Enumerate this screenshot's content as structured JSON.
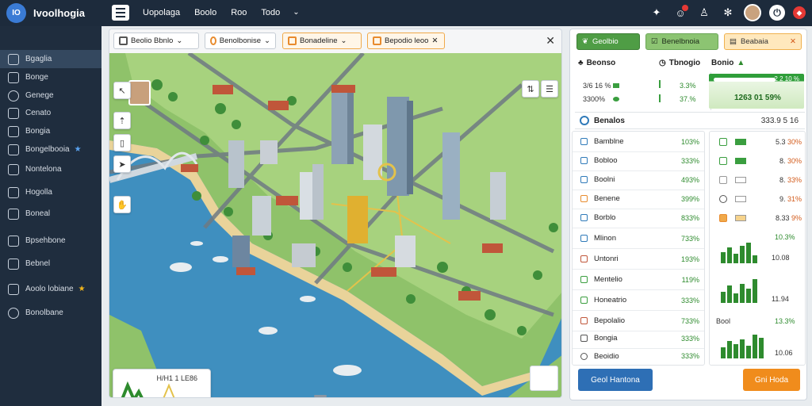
{
  "app": {
    "name": "Ivoolhogia",
    "logo_text": "IO"
  },
  "top_menu": {
    "items": [
      "Uopolaga",
      "Boolo",
      "Roo",
      "Todo"
    ]
  },
  "sidebar": {
    "items": [
      {
        "label": "Bgaglia",
        "active": true
      },
      {
        "label": "Bonge"
      },
      {
        "label": "Genege"
      },
      {
        "label": "Cenato"
      },
      {
        "label": "Bongia"
      },
      {
        "label": "Bongelbooia",
        "blue_star": true
      },
      {
        "label": "Nontelona"
      },
      {
        "label": "Hogolla"
      },
      {
        "label": "Boneal"
      },
      {
        "label": "Bpsehbone"
      },
      {
        "label": "Bebnel"
      },
      {
        "label": "Aoolo lobiane",
        "star": true
      },
      {
        "label": "Bonolbane"
      }
    ]
  },
  "map_tabs": {
    "tab1": "Beolio    Bbnlo",
    "tab2": "Benolbonise",
    "tab3": "Bonadeline",
    "tab4": "Bepodio  leoo"
  },
  "map_widget": {
    "text": "H/H1 1 LE86"
  },
  "right": {
    "tab1": "Geolbio",
    "tab2": "Benelbnoia",
    "tab3": "Beabaia",
    "summary_left_title": "Beonso",
    "summary_mid_title": "Tbnogio",
    "summary_right_title": "Bonio",
    "sum_rows": [
      {
        "v1": "3/6 16 %",
        "v2": "3.3%"
      },
      {
        "v1": "3300%",
        "v2": "37.%"
      }
    ],
    "green_card": {
      "top": "2 2 10 %",
      "value": "1263 01 59%"
    },
    "section": {
      "label": "Benalos",
      "value": "333.9 5 16"
    },
    "list": [
      {
        "label": "Bamblne",
        "value": "103%"
      },
      {
        "label": "Bobloo",
        "value": "333%"
      },
      {
        "label": "Boolni",
        "value": "493%"
      },
      {
        "label": "Benene",
        "value": "399%"
      },
      {
        "label": "Borblo",
        "value": "833%"
      },
      {
        "label": "Mlinon",
        "value": "733%"
      },
      {
        "label": "Untonri",
        "value": "193%"
      },
      {
        "label": "Mentelio",
        "value": "119%"
      },
      {
        "label": "Honeatrio",
        "value": "333%"
      },
      {
        "label": "Bepolalio",
        "value": "733%"
      },
      {
        "label": "Bongia",
        "value": "333%"
      },
      {
        "label": "Beoidio",
        "value": "333%"
      }
    ],
    "spark": {
      "rows": [
        {
          "a": "5.3",
          "b": "30%"
        },
        {
          "a": "8.",
          "b": "30%"
        },
        {
          "a": "8.",
          "b": "33%"
        },
        {
          "a": "9.",
          "b": "31%"
        },
        {
          "a": "8.33",
          "b": "9%"
        }
      ],
      "g1_top": "10.3%",
      "g1_bot": "10.08",
      "g2_bot": "11.94",
      "g3_left": "Bool",
      "g3_top": "13.3%",
      "g3_bot": "10.06"
    },
    "btn_blue": "Geol Hantona",
    "btn_orange": "Gni Hoda"
  }
}
